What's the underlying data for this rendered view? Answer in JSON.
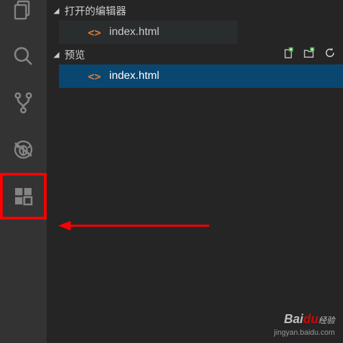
{
  "sections": {
    "open_editors": {
      "label": "打开的编辑器"
    },
    "preview": {
      "label": "预览"
    }
  },
  "files": {
    "open_editor_item": "index.html",
    "preview_item": "index.html"
  },
  "watermark": {
    "brand_main": "Bai",
    "brand_du": "du",
    "brand_sub": "经验",
    "url": "jingyan.baidu.com"
  },
  "colors": {
    "highlight_box": "#ff0000",
    "selection": "#094771",
    "accent_green": "#4caf50",
    "code_icon": "#e37933"
  }
}
